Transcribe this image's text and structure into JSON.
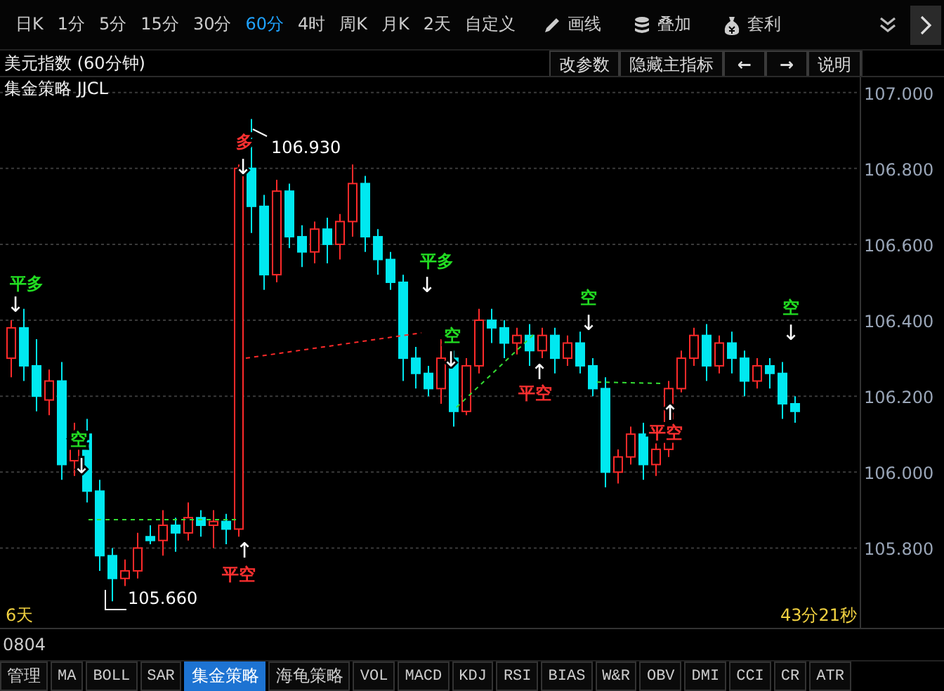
{
  "toolbar": {
    "periods": [
      {
        "label": "日K",
        "selected": false
      },
      {
        "label": "1分",
        "selected": false
      },
      {
        "label": "5分",
        "selected": false
      },
      {
        "label": "15分",
        "selected": false
      },
      {
        "label": "30分",
        "selected": false
      },
      {
        "label": "60分",
        "selected": true
      },
      {
        "label": "4时",
        "selected": false
      },
      {
        "label": "周K",
        "selected": false
      },
      {
        "label": "月K",
        "selected": false
      },
      {
        "label": "2天",
        "selected": false
      },
      {
        "label": "自定义",
        "selected": false
      }
    ],
    "tools": [
      {
        "label": "画线",
        "kind": "draw"
      },
      {
        "label": "叠加",
        "kind": "overlay"
      },
      {
        "label": "套利",
        "kind": "arbitrage"
      }
    ]
  },
  "chart_header": {
    "title": "美元指数 (60分钟)",
    "buttons": [
      "改参数",
      "隐藏主指标",
      "←",
      "→",
      "说明"
    ]
  },
  "chart": {
    "indicator": "集金策略 JJCL",
    "chart_data": {
      "type": "candlestick",
      "ylim": [
        105.59,
        107.04
      ],
      "grid": true,
      "yticks": [
        {
          "value": 107,
          "label": "107.000"
        },
        {
          "value": 106.8,
          "label": "106.800"
        },
        {
          "value": 106.6,
          "label": "106.600"
        },
        {
          "value": 106.4,
          "label": "106.400"
        },
        {
          "value": 106.2,
          "label": "106.200"
        },
        {
          "value": 106.0,
          "label": "106.000"
        },
        {
          "value": 105.8,
          "label": "105.800"
        }
      ],
      "ohlc": [
        [
          106.3,
          106.4,
          106.25,
          106.38
        ],
        [
          106.38,
          106.43,
          106.24,
          106.28
        ],
        [
          106.28,
          106.35,
          106.16,
          106.2
        ],
        [
          106.19,
          106.27,
          106.15,
          106.24
        ],
        [
          106.24,
          106.29,
          105.98,
          106.02
        ],
        [
          106.03,
          106.13,
          105.99,
          106.1
        ],
        [
          106.1,
          106.14,
          105.92,
          105.95
        ],
        [
          105.95,
          105.98,
          105.74,
          105.78
        ],
        [
          105.78,
          105.8,
          105.66,
          105.72
        ],
        [
          105.72,
          105.77,
          105.7,
          105.74
        ],
        [
          105.74,
          105.84,
          105.72,
          105.8
        ],
        [
          105.83,
          105.86,
          105.81,
          105.82
        ],
        [
          105.82,
          105.9,
          105.78,
          105.86
        ],
        [
          105.86,
          105.88,
          105.79,
          105.84
        ],
        [
          105.84,
          105.92,
          105.82,
          105.88
        ],
        [
          105.88,
          105.9,
          105.83,
          105.86
        ],
        [
          105.86,
          105.9,
          105.8,
          105.87
        ],
        [
          105.87,
          105.89,
          105.81,
          105.85
        ],
        [
          105.85,
          106.81,
          105.83,
          106.8
        ],
        [
          106.8,
          106.93,
          106.63,
          106.7
        ],
        [
          106.7,
          106.73,
          106.48,
          106.52
        ],
        [
          106.52,
          106.77,
          106.5,
          106.74
        ],
        [
          106.74,
          106.76,
          106.59,
          106.62
        ],
        [
          106.62,
          106.65,
          106.54,
          106.58
        ],
        [
          106.58,
          106.66,
          106.55,
          106.64
        ],
        [
          106.64,
          106.67,
          106.55,
          106.6
        ],
        [
          106.6,
          106.68,
          106.56,
          106.66
        ],
        [
          106.66,
          106.81,
          106.62,
          106.76
        ],
        [
          106.76,
          106.78,
          106.58,
          106.62
        ],
        [
          106.62,
          106.64,
          106.52,
          106.56
        ],
        [
          106.56,
          106.58,
          106.48,
          106.5
        ],
        [
          106.5,
          106.52,
          106.24,
          106.3
        ],
        [
          106.3,
          106.33,
          106.22,
          106.26
        ],
        [
          106.26,
          106.28,
          106.2,
          106.22
        ],
        [
          106.22,
          106.35,
          106.18,
          106.3
        ],
        [
          106.3,
          106.32,
          106.12,
          106.16
        ],
        [
          106.16,
          106.3,
          106.15,
          106.28
        ],
        [
          106.28,
          106.43,
          106.26,
          106.4
        ],
        [
          106.4,
          106.43,
          106.34,
          106.38
        ],
        [
          106.38,
          106.4,
          106.3,
          106.34
        ],
        [
          106.34,
          106.38,
          106.31,
          106.36
        ],
        [
          106.36,
          106.39,
          106.28,
          106.32
        ],
        [
          106.32,
          106.38,
          106.3,
          106.36
        ],
        [
          106.36,
          106.38,
          106.26,
          106.3
        ],
        [
          106.3,
          106.36,
          106.28,
          106.34
        ],
        [
          106.34,
          106.37,
          106.26,
          106.28
        ],
        [
          106.28,
          106.3,
          106.2,
          106.22
        ],
        [
          106.22,
          106.25,
          105.96,
          106.0
        ],
        [
          106.0,
          106.06,
          105.97,
          106.04
        ],
        [
          106.04,
          106.12,
          106.02,
          106.1
        ],
        [
          106.1,
          106.13,
          105.98,
          106.02
        ],
        [
          106.02,
          106.08,
          105.99,
          106.06
        ],
        [
          106.06,
          106.24,
          106.04,
          106.22
        ],
        [
          106.22,
          106.32,
          106.21,
          106.3
        ],
        [
          106.3,
          106.38,
          106.28,
          106.36
        ],
        [
          106.36,
          106.39,
          106.24,
          106.28
        ],
        [
          106.28,
          106.36,
          106.26,
          106.34
        ],
        [
          106.34,
          106.37,
          106.26,
          106.3
        ],
        [
          106.3,
          106.32,
          106.2,
          106.24
        ],
        [
          106.24,
          106.3,
          106.22,
          106.28
        ],
        [
          106.28,
          106.3,
          106.22,
          106.26
        ],
        [
          106.26,
          106.29,
          106.14,
          106.18
        ],
        [
          106.18,
          106.2,
          106.13,
          106.16
        ]
      ]
    },
    "high_label": "106.930",
    "low_label": "105.660",
    "signals": [
      {
        "label": "平多",
        "kind": "sell",
        "arrow": "↓"
      },
      {
        "label": "空",
        "kind": "sell",
        "arrow": "↓"
      },
      {
        "label": "多",
        "kind": "buy",
        "arrow": "↓"
      },
      {
        "label": "平空",
        "kind": "buy",
        "arrow": "↑"
      },
      {
        "label": "平多",
        "kind": "sell",
        "arrow": "↓"
      },
      {
        "label": "空",
        "kind": "sell",
        "arrow": "↓"
      },
      {
        "label": "平空",
        "kind": "buy",
        "arrow": "↑"
      },
      {
        "label": "空",
        "kind": "sell",
        "arrow": "↓"
      },
      {
        "label": "平空",
        "kind": "buy",
        "arrow": "↑"
      },
      {
        "label": "空",
        "kind": "sell",
        "arrow": "↓"
      }
    ],
    "span": "6天",
    "countdown": "43分21秒"
  },
  "status": {
    "code": "0804"
  },
  "indicator_tabs": [
    {
      "label": "管理",
      "selected": false
    },
    {
      "label": "MA",
      "selected": false
    },
    {
      "label": "BOLL",
      "selected": false
    },
    {
      "label": "SAR",
      "selected": false
    },
    {
      "label": "集金策略",
      "selected": true
    },
    {
      "label": "海龟策略",
      "selected": false
    },
    {
      "label": "VOL",
      "selected": false
    },
    {
      "label": "MACD",
      "selected": false
    },
    {
      "label": "KDJ",
      "selected": false
    },
    {
      "label": "RSI",
      "selected": false
    },
    {
      "label": "BIAS",
      "selected": false
    },
    {
      "label": "W&R",
      "selected": false
    },
    {
      "label": "OBV",
      "selected": false
    },
    {
      "label": "DMI",
      "selected": false
    },
    {
      "label": "CCI",
      "selected": false
    },
    {
      "label": "CR",
      "selected": false
    },
    {
      "label": "ATR",
      "selected": false
    }
  ]
}
